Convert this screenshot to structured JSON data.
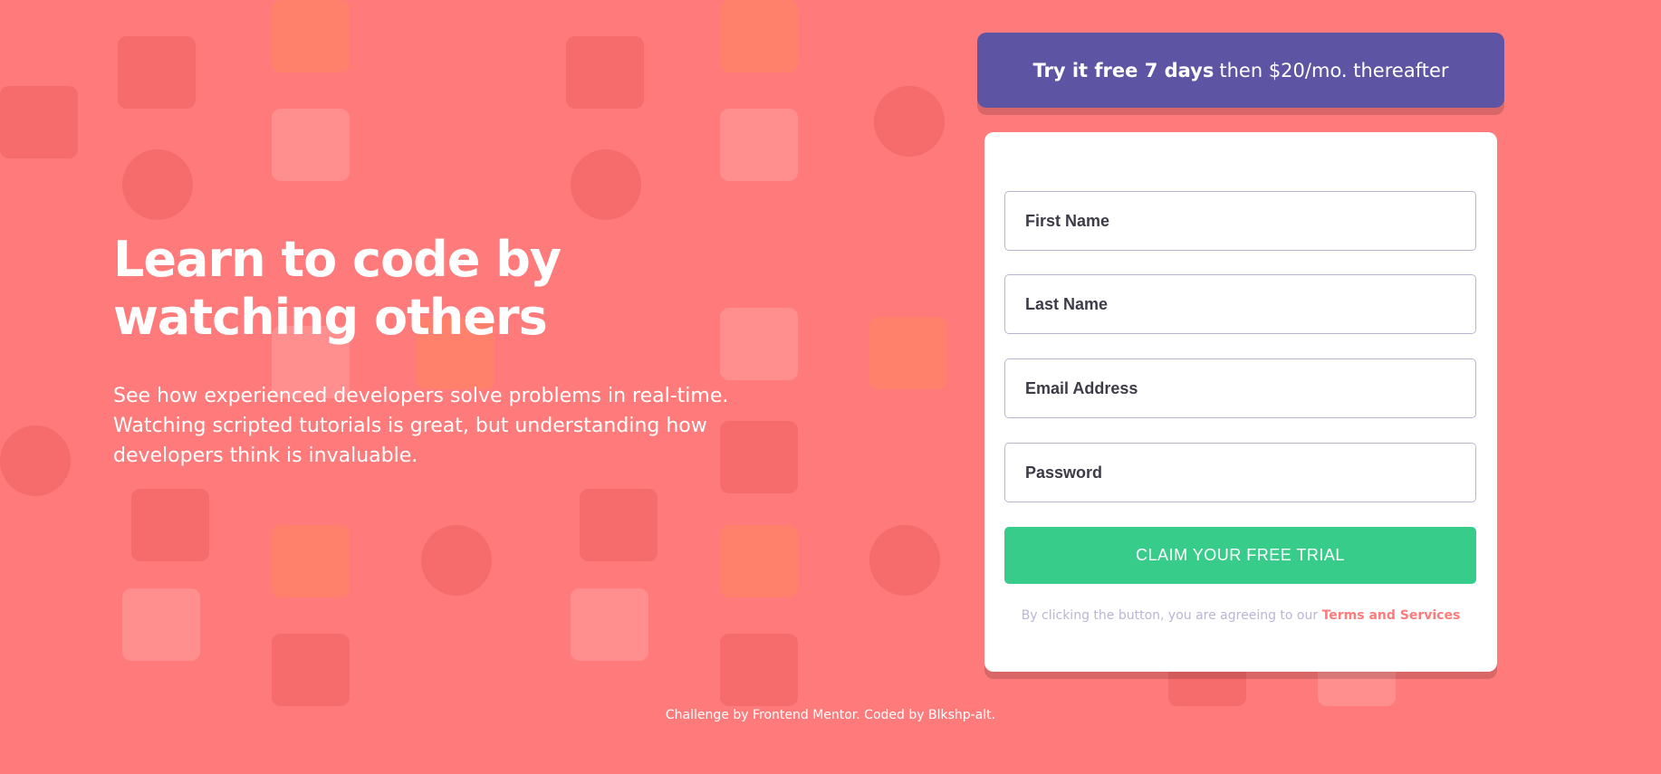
{
  "hero": {
    "title": "Learn to code by watching others",
    "description": "See how experienced developers solve problems in real-time. Watching scripted tutorials is great, but understanding how developers think is invaluable."
  },
  "promo": {
    "bold_text": "Try it free 7 days",
    "rest_text": "then $20/mo. thereafter"
  },
  "form": {
    "fields": [
      {
        "placeholder": "First Name",
        "value": ""
      },
      {
        "placeholder": "Last Name",
        "value": ""
      },
      {
        "placeholder": "Email Address",
        "value": ""
      },
      {
        "placeholder": "Password",
        "value": ""
      }
    ],
    "submit_label": "CLAIM YOUR FREE TRIAL",
    "terms_prefix": "By clicking the button, you are agreeing to our",
    "terms_link": "Terms and Services"
  },
  "footer": {
    "text": "Challenge by Frontend Mentor. Coded by Blkshp-alt."
  },
  "colors": {
    "background": "#ff7a7a",
    "banner": "#5e54a4",
    "submit": "#38cc8b",
    "link": "#ff7a7a",
    "muted": "#b9b6d3"
  }
}
